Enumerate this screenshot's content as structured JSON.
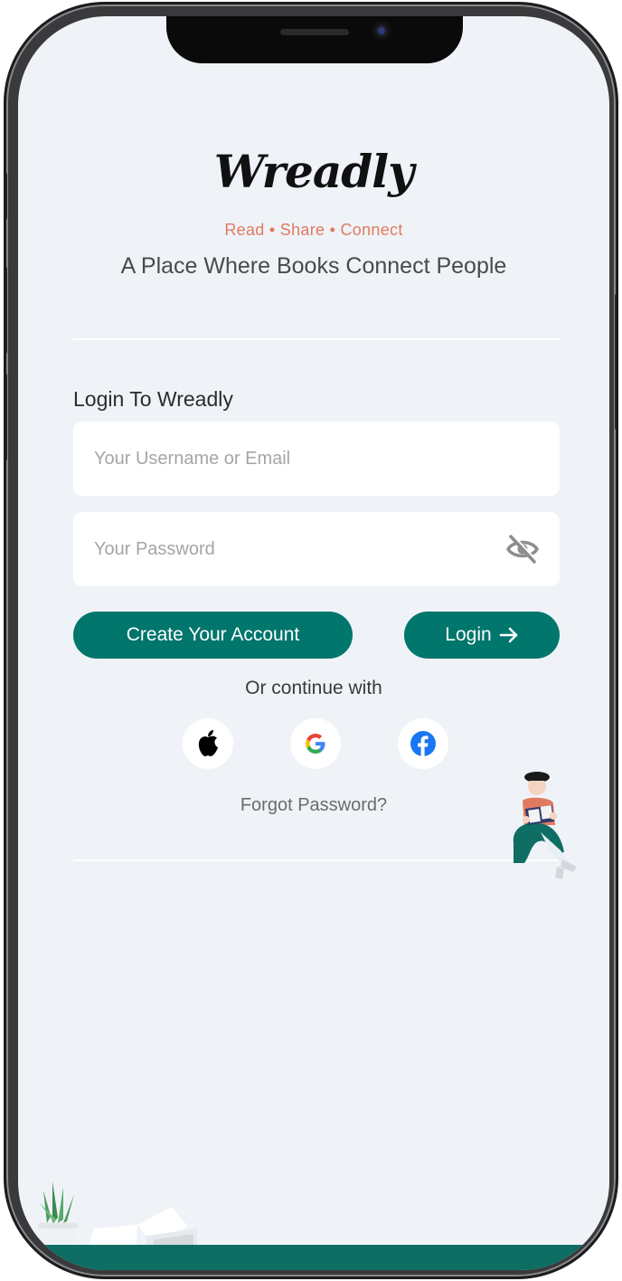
{
  "app": {
    "logo_text": "Wreadly",
    "tagline": "Read • Share • Connect",
    "subtitle": "A Place Where Books Connect People"
  },
  "login": {
    "heading": "Login To Wreadly",
    "username_placeholder": "Your Username or Email",
    "username_value": "",
    "password_placeholder": "Your Password",
    "password_value": "",
    "create_account_label": "Create Your Account",
    "login_label": "Login",
    "or_continue": "Or continue with",
    "forgot_password": "Forgot Password?"
  },
  "social_providers": [
    "apple-icon",
    "google-icon",
    "facebook-icon"
  ],
  "colors": {
    "background": "#eff3f8",
    "primary": "#00766c",
    "tagline": "#e07a5f",
    "facebook": "#1877f2"
  }
}
